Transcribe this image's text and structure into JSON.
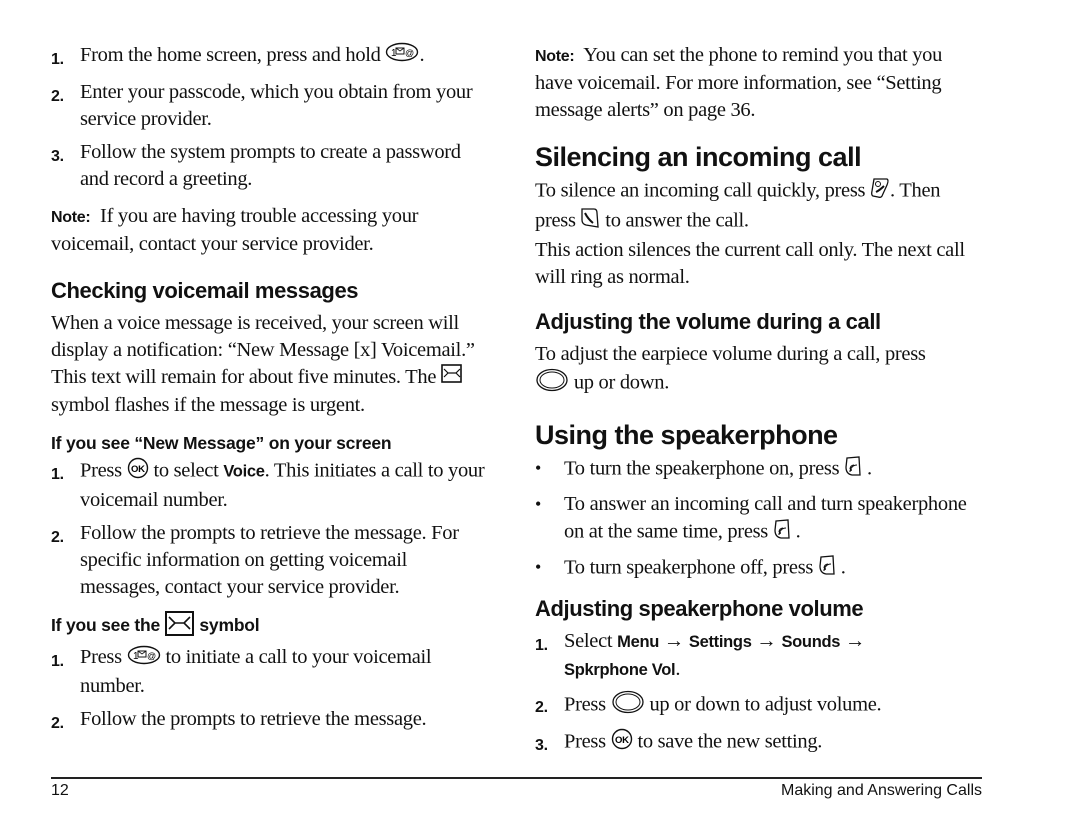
{
  "left": {
    "intro_steps": [
      {
        "num": "1.",
        "text_a": "From the home screen, press and hold",
        "icon": "voicemail-key-icon",
        "text_b": "."
      },
      {
        "num": "2.",
        "text": "Enter your passcode, which you obtain from your service provider."
      },
      {
        "num": "3.",
        "text": "Follow the system prompts to create a password and record a greeting."
      }
    ],
    "note1": {
      "label": "Note:",
      "text": "If you are having trouble accessing your voicemail, contact your service provider."
    },
    "checking": {
      "heading": "Checking voicemail messages",
      "para_a": "When a voice message is received, your screen will display a notification: “New Message [x] Voicemail.” This text will remain for about five minutes. The",
      "para_b": "symbol flashes if the message is urgent."
    },
    "new_message": {
      "heading": "If you see “New Message” on your screen",
      "steps": [
        {
          "num": "1.",
          "text_a": "Press",
          "text_b": "to select",
          "bold": "Voice",
          "text_c": ". This initiates a call to your voicemail number."
        },
        {
          "num": "2.",
          "text": "Follow the prompts to retrieve the message. For specific information on getting voicemail messages, contact your service provider."
        }
      ]
    },
    "symbol_section": {
      "heading_a": "If you see the",
      "heading_b": "symbol",
      "steps": [
        {
          "num": "1.",
          "text_a": "Press",
          "text_b": "to initiate a call to your voicemail number."
        },
        {
          "num": "2.",
          "text": "Follow the prompts to retrieve the message."
        }
      ]
    }
  },
  "right": {
    "note2": {
      "label": "Note:",
      "text": "You can set the phone to remind you that you have voicemail. For more information, see “Setting message alerts” on page 36."
    },
    "silencing": {
      "heading": "Silencing an incoming call",
      "line1_a": "To silence an incoming call quickly, press",
      "line1_b": ". Then press",
      "line1_c": "to answer the call.",
      "para2": "This action silences the current call only. The next call will ring as normal."
    },
    "volume_call": {
      "heading": "Adjusting the volume during a call",
      "text_a": "To adjust the earpiece volume during a call, press",
      "text_b": "up or down."
    },
    "speakerphone": {
      "heading": "Using the speakerphone",
      "bullets": [
        {
          "text": "To turn the speakerphone on, press",
          "end": "."
        },
        {
          "text": "To answer an incoming call and turn speakerphone on at the same time, press",
          "end": "."
        },
        {
          "text": "To turn speakerphone off, press",
          "end": "."
        }
      ]
    },
    "spk_volume": {
      "heading": "Adjusting speakerphone volume",
      "step1": {
        "num": "1.",
        "text": "Select",
        "menu": "Menu",
        "arrow": "→",
        "settings": "Settings",
        "sounds": "Sounds",
        "vol": "Spkrphone Vol",
        "end": "."
      },
      "step2": {
        "num": "2.",
        "text_a": "Press",
        "text_b": "up or down to adjust volume."
      },
      "step3": {
        "num": "3.",
        "text_a": "Press",
        "text_b": "to save the new setting."
      }
    }
  },
  "footer": {
    "page_number": "12",
    "chapter": "Making and Answering Calls"
  }
}
